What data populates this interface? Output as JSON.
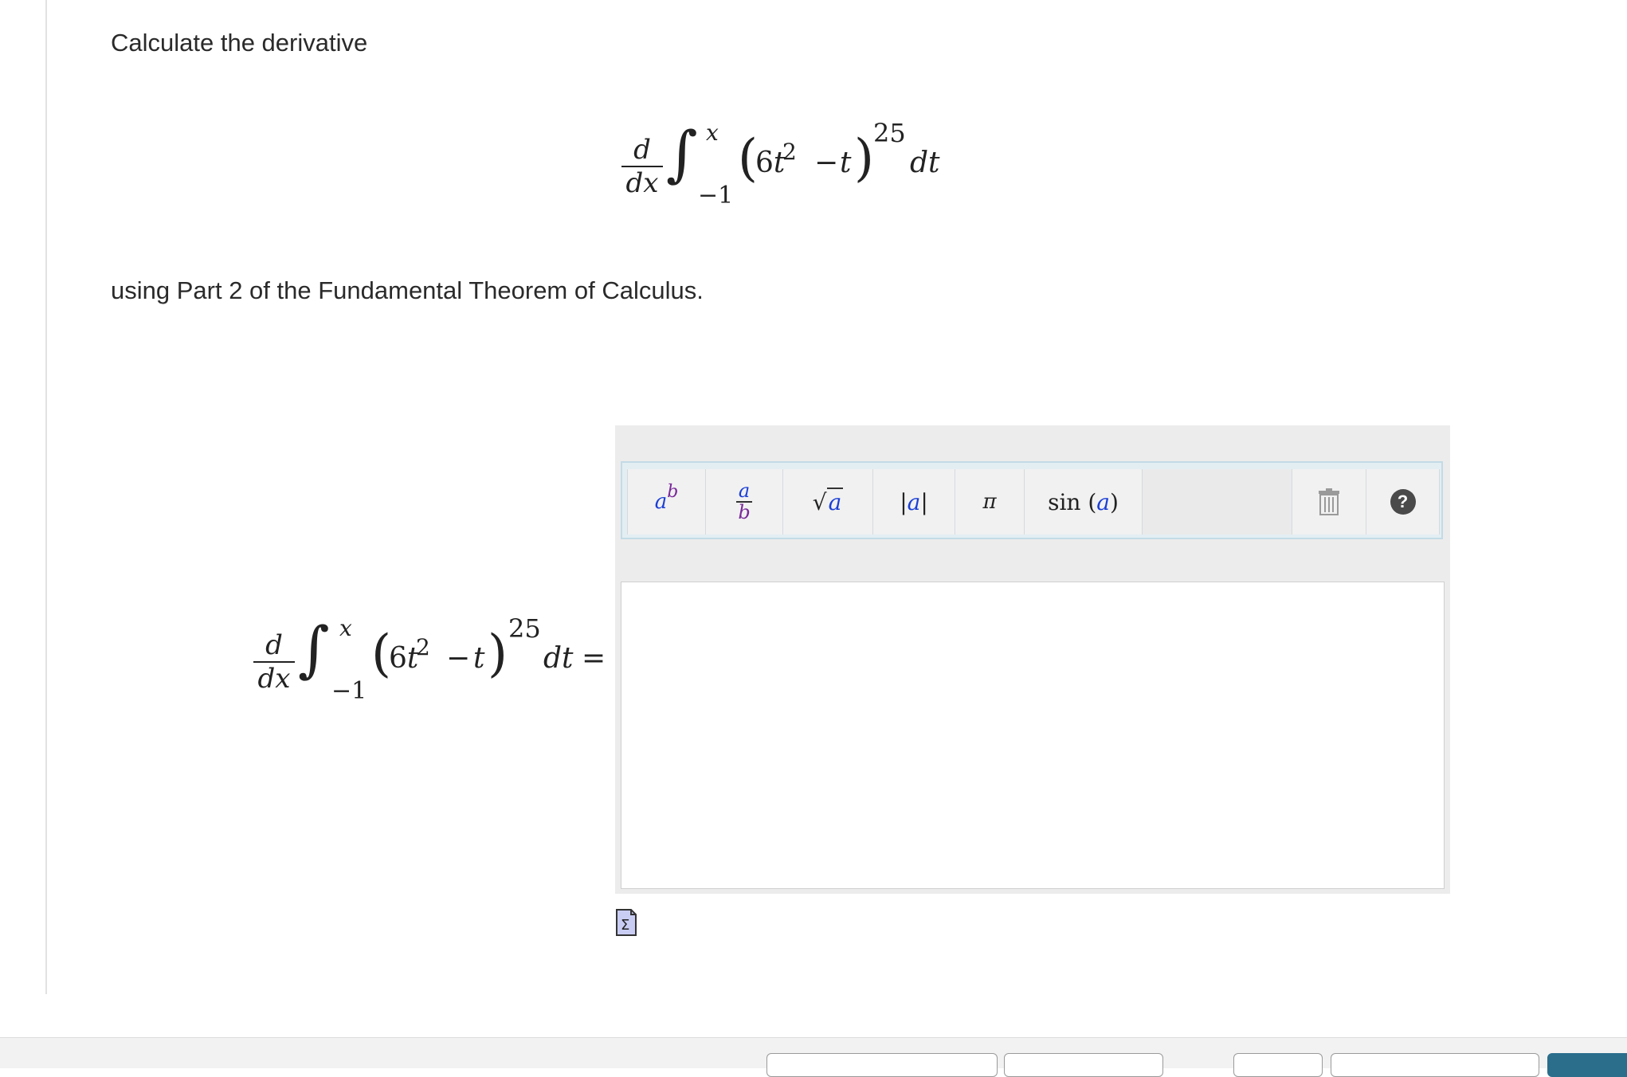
{
  "question": {
    "intro": "Calculate the derivative",
    "outro": "using Part 2 of the Fundamental Theorem of Calculus."
  },
  "expression": {
    "d_num": "d",
    "d_den": "dx",
    "upper_limit": "x",
    "lower_limit": "−1",
    "base": "6t",
    "inner_exp": "2",
    "minus": "−",
    "var": "t",
    "outer_exp": "25",
    "differential": "dt",
    "equals": "="
  },
  "toolbar": {
    "power": {
      "base": "a",
      "exp": "b"
    },
    "fraction": {
      "num": "a",
      "den": "b"
    },
    "sqrt": {
      "radical": "√",
      "arg": "a"
    },
    "abs": {
      "bar": "|",
      "arg": "a"
    },
    "pi": "π",
    "sin": {
      "fn": "sin",
      "arg": "a"
    },
    "help": "?"
  },
  "colors": {
    "accent_blue": "#1b3fd6",
    "accent_purple": "#7a2a9a",
    "primary_button": "#2b6e8c"
  }
}
